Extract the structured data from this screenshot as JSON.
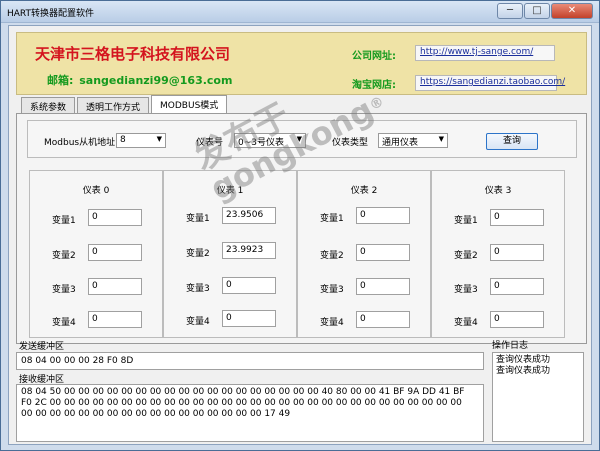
{
  "window": {
    "title": "HART转换器配置软件",
    "minimize": "─",
    "maximize": "□",
    "close": "✕"
  },
  "banner": {
    "company": "天津市三格电子科技有限公司",
    "email_label": "邮箱:",
    "email": "sangedianzi99@163.com",
    "site_label": "公司网址:",
    "site_url": "http://www.tj-sange.com/",
    "shop_label": "淘宝网店:",
    "shop_url": "https://sangedianzi.taobao.com/"
  },
  "tabs": [
    {
      "label": "系统参数"
    },
    {
      "label": "透明工作方式"
    },
    {
      "label": "MODBUS模式"
    }
  ],
  "query": {
    "slave_label": "Modbus从机地址",
    "slave_value": "8",
    "meter_label": "仪表号",
    "meter_value": "0~3号仪表",
    "type_label": "仪表类型",
    "type_value": "通用仪表",
    "button": "查询"
  },
  "meters": [
    {
      "title": "仪表 0",
      "vars": [
        {
          "label": "变量1",
          "value": "0"
        },
        {
          "label": "变量2",
          "value": "0"
        },
        {
          "label": "变量3",
          "value": "0"
        },
        {
          "label": "变量4",
          "value": "0"
        }
      ]
    },
    {
      "title": "仪表 1",
      "vars": [
        {
          "label": "变量1",
          "value": "23.9506"
        },
        {
          "label": "变量2",
          "value": "23.9923"
        },
        {
          "label": "变量3",
          "value": "0"
        },
        {
          "label": "变量4",
          "value": "0"
        }
      ]
    },
    {
      "title": "仪表 2",
      "vars": [
        {
          "label": "变量1",
          "value": "0"
        },
        {
          "label": "变量2",
          "value": "0"
        },
        {
          "label": "变量3",
          "value": "0"
        },
        {
          "label": "变量4",
          "value": "0"
        }
      ]
    },
    {
      "title": "仪表 3",
      "vars": [
        {
          "label": "变量1",
          "value": "0"
        },
        {
          "label": "变量2",
          "value": "0"
        },
        {
          "label": "变量3",
          "value": "0"
        },
        {
          "label": "变量4",
          "value": "0"
        }
      ]
    }
  ],
  "send": {
    "label": "发送缓冲区",
    "value": "08 04 00 00 00 28 F0 8D"
  },
  "receive": {
    "label": "接收缓冲区",
    "lines": [
      "08 04 50 00 00 00 00 00 00 00 00 00 00 00 00 00 00 00 00 00 00 40 80 00 00 41 BF 9A DD 41 BF",
      "F0 2C 00 00 00 00 00 00 00 00 00 00 00 00 00 00 00 00 00 00 00 00 00 00 00 00 00 00 00 00 00",
      "00 00 00 00 00 00 00 00 00 00 00 00 00 00 00 00 00 17 49"
    ]
  },
  "log": {
    "label": "操作日志",
    "lines": [
      "查询仪表成功",
      "查询仪表成功"
    ]
  },
  "watermark": {
    "line1": "发布于",
    "line2": "gongkong",
    "reg": "®"
  }
}
